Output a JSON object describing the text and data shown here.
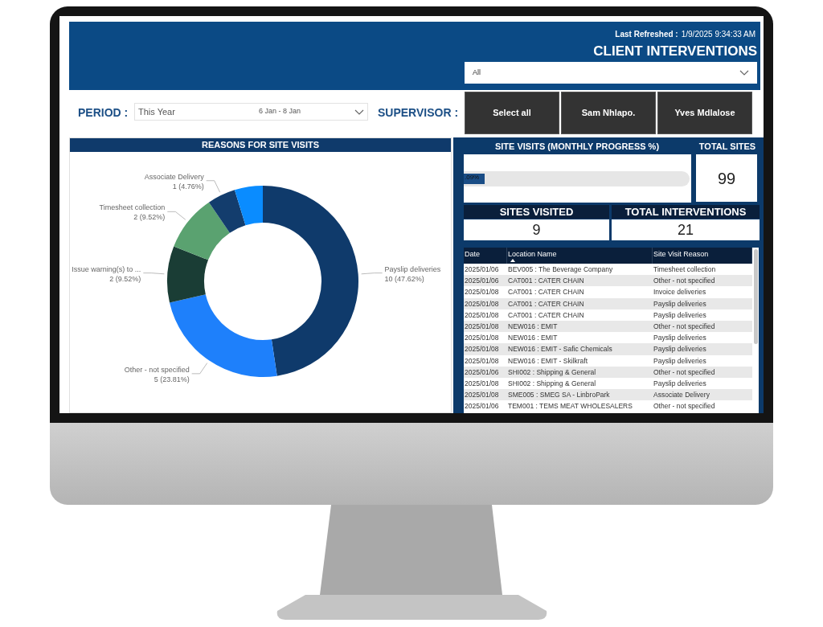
{
  "header": {
    "last_refreshed_label": "Last Refreshed :",
    "last_refreshed": "1/9/2025 9:34:33 AM",
    "title": "CLIENT INTERVENTIONS",
    "client_filter": {
      "value": "All"
    }
  },
  "period": {
    "label": "PERIOD :",
    "value": "This Year",
    "range": "6 Jan - 8 Jan"
  },
  "supervisor": {
    "label": "SUPERVISOR :",
    "buttons": [
      "Select all",
      "Sam Nhlapo.",
      "Yves Mdlalose"
    ]
  },
  "reasons": {
    "title": "REASONS FOR SITE VISITS",
    "chart_data": {
      "type": "donut",
      "categories": [
        "Payslip deliveries",
        "Other - not specified",
        "Issue warning(s) to ...",
        "Timesheet collection",
        "Associate Delivery",
        null
      ],
      "values": [
        10,
        5,
        2,
        2,
        1,
        1
      ],
      "value_labels": [
        "10 (47.62%)",
        "5 (23.81%)",
        "2 (9.52%)",
        "2 (9.52%)",
        "1 (4.76%)",
        null
      ],
      "colors": [
        "#0f3a6b",
        "#1e80fb",
        "#1a3d35",
        "#5aa270",
        "#133d6d",
        "#0a8cff"
      ]
    }
  },
  "progress": {
    "title": "SITE VISITS (MONTHLY PROGRESS %)",
    "level": 0.0909,
    "reading": ".09%"
  },
  "total_sites": {
    "label": "TOTAL SITES",
    "value": "99"
  },
  "sites_visited": {
    "label": "SITES VISITED",
    "value": "9"
  },
  "total_interventions": {
    "label": "TOTAL INTERVENTIONS",
    "value": "21"
  },
  "table": {
    "columns": [
      {
        "label": "Date",
        "sorted": false
      },
      {
        "label": "Location Name",
        "sorted": true
      },
      {
        "label": "Site Visit Reason",
        "sorted": false
      }
    ],
    "rows": [
      [
        "2025/01/06",
        "BEV005 : The Beverage Company",
        "Timesheet collection"
      ],
      [
        "2025/01/06",
        "CAT001 : CATER CHAIN",
        "Other - not specified"
      ],
      [
        "2025/01/08",
        "CAT001 : CATER CHAIN",
        "Invoice deliveries"
      ],
      [
        "2025/01/08",
        "CAT001 : CATER CHAIN",
        "Payslip deliveries"
      ],
      [
        "2025/01/08",
        "CAT001 : CATER CHAIN",
        "Payslip deliveries"
      ],
      [
        "2025/01/08",
        "NEW016 : EMIT",
        "Other - not specified"
      ],
      [
        "2025/01/08",
        "NEW016 : EMIT",
        "Payslip deliveries"
      ],
      [
        "2025/01/08",
        "NEW016 : EMIT - Safic Chemicals",
        "Payslip deliveries"
      ],
      [
        "2025/01/08",
        "NEW016 : EMIT - Skilkraft",
        "Payslip deliveries"
      ],
      [
        "2025/01/06",
        "SHI002 : Shipping & General",
        "Other - not specified"
      ],
      [
        "2025/01/08",
        "SHI002 : Shipping & General",
        "Payslip deliveries"
      ],
      [
        "2025/01/08",
        "SME005 : SMEG SA - LinbroPark",
        "Associate Delivery"
      ],
      [
        "2025/01/06",
        "TEM001 : TEMS MEAT WHOLESALERS",
        "Other - not specified"
      ]
    ]
  }
}
